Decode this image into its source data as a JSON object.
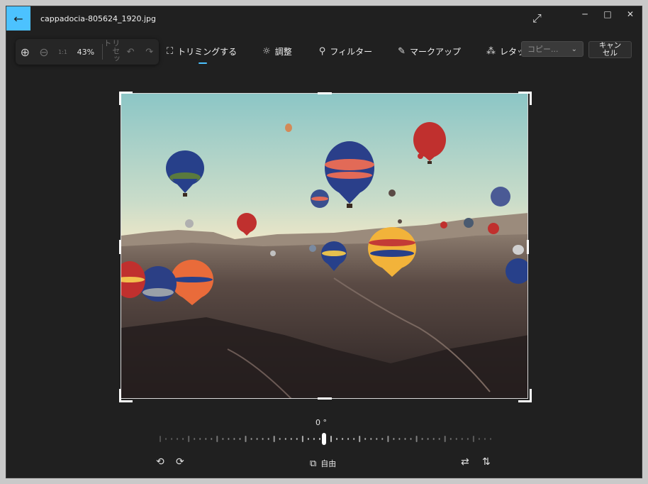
{
  "titlebar": {
    "filename": "cappadocia-805624_1920.jpg",
    "back_icon": "←",
    "expand_icon": "⤢",
    "minimize_icon": "─",
    "maximize_icon": "□",
    "close_icon": "✕",
    "accent_color": "#4cc2ff"
  },
  "zoombar": {
    "zoom_in_icon": "⊕",
    "zoom_out_icon": "⊖",
    "actual_size_icon": "1:1",
    "zoom_percent": "43%",
    "reset_label": "リセット",
    "undo_icon": "↶",
    "redo_icon": "↷"
  },
  "toolbar": {
    "crop": {
      "icon": "⛶",
      "label": "トリミングする"
    },
    "adjust": {
      "icon": "☼",
      "label": "調整"
    },
    "filter": {
      "icon": "⚲",
      "label": "フィルター"
    },
    "markup": {
      "icon": "✎",
      "label": "マークアップ"
    },
    "retouch": {
      "icon": "⁂",
      "label": "レタッチ"
    }
  },
  "actions": {
    "copy_label": "コピー...",
    "copy_chevron": "⌄",
    "cancel_label_line1": "キャン",
    "cancel_label_line2": "セル"
  },
  "straighten": {
    "angle": "0 °",
    "angle_value": 0
  },
  "bottom_bar": {
    "rotate_left_icon": "⟲",
    "rotate_right_icon": "⟳",
    "aspect_icon": "⧉",
    "aspect_label": "自由",
    "flip_horizontal_icon": "⇄",
    "flip_vertical_icon": "⇅"
  }
}
